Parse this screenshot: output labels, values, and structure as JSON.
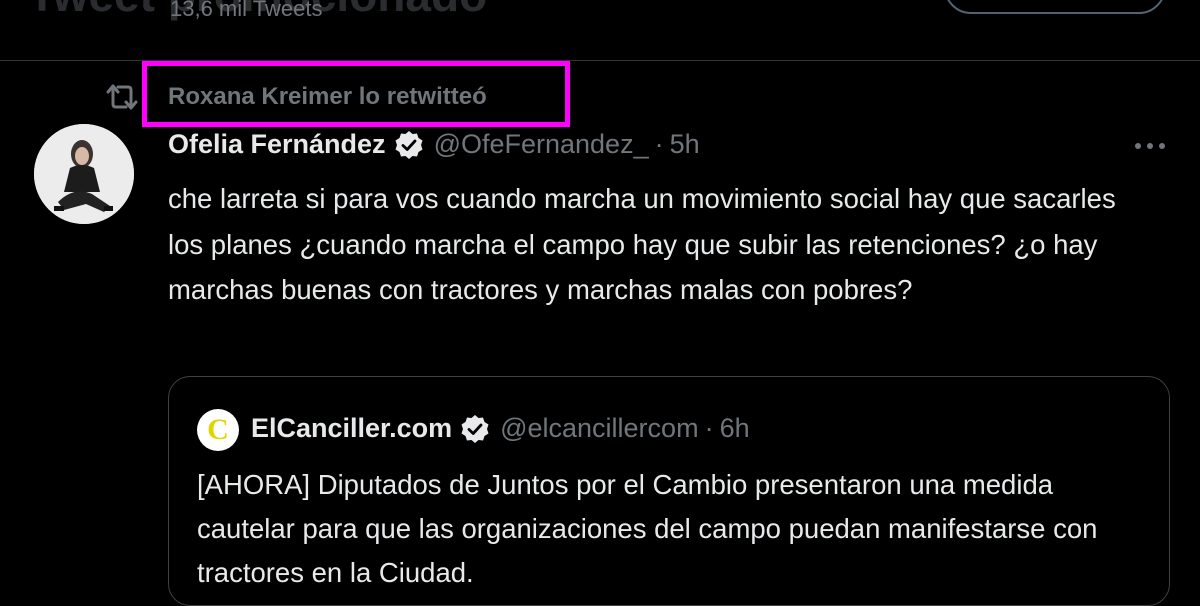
{
  "header": {
    "title": "Tweet promocionado",
    "subtitle": "13,6 mil Tweets"
  },
  "retweet": {
    "icon": "retweet-icon",
    "label": "Roxana Kreimer lo retwitteó",
    "highlight_color": "#ff00ff"
  },
  "tweet": {
    "author_name": "Ofelia Fernández",
    "author_handle": "@OfeFernandez_",
    "separator": "·",
    "time": "5h",
    "more_icon": "more-horizontal-icon",
    "text": "che larreta si para vos cuando marcha un movimiento social hay que sacarles los planes ¿cuando marcha el campo hay que subir las retenciones? ¿o hay marchas buenas con tractores y marchas malas con pobres?"
  },
  "quoted_tweet": {
    "avatar_letter": "C",
    "author_name": "ElCanciller.com",
    "author_handle": "@elcancillercom",
    "separator": "·",
    "time": "6h",
    "text": "[AHORA] Diputados de Juntos por el Cambio presentaron una medida cautelar para que las organizaciones del campo puedan manifestarse con tractores en la Ciudad."
  },
  "colors": {
    "background": "#000000",
    "text_primary": "#e7e9ea",
    "text_secondary": "#71767b",
    "border": "#2f3336"
  }
}
